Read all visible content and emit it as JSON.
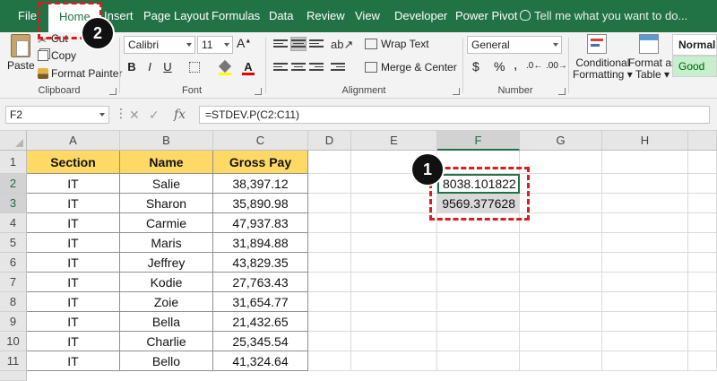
{
  "tabs": [
    {
      "id": "file",
      "label": "File"
    },
    {
      "id": "home",
      "label": "Home"
    },
    {
      "id": "insert",
      "label": "Insert"
    },
    {
      "id": "page-layout",
      "label": "Page Layout"
    },
    {
      "id": "formulas",
      "label": "Formulas"
    },
    {
      "id": "data",
      "label": "Data"
    },
    {
      "id": "review",
      "label": "Review"
    },
    {
      "id": "view",
      "label": "View"
    },
    {
      "id": "developer",
      "label": "Developer"
    },
    {
      "id": "power-pivot",
      "label": "Power Pivot"
    }
  ],
  "active_tab": "Home",
  "tell_me": "Tell me what you want to do...",
  "ribbon": {
    "clipboard": {
      "label": "Clipboard",
      "paste": "Paste",
      "cut": "Cut",
      "copy": "Copy",
      "format_painter": "Format Painter"
    },
    "font": {
      "label": "Font",
      "name": "Calibri",
      "size": "11",
      "bold": "B",
      "italic": "I",
      "underline": "U"
    },
    "alignment": {
      "label": "Alignment",
      "wrap_text": "Wrap Text",
      "merge_center": "Merge & Center"
    },
    "number": {
      "label": "Number",
      "format": "General",
      "currency": "$",
      "percent": "%",
      "comma": ","
    },
    "styles": {
      "conditional_formatting_1": "Conditional",
      "conditional_formatting_2": "Formatting",
      "format_as_table_1": "Format as",
      "format_as_table_2": "Table",
      "normal": "Normal",
      "good": "Good"
    }
  },
  "formula_bar": {
    "name_box": "F2",
    "fx": "fx",
    "formula": "=STDEV.P(C2:C11)"
  },
  "grid": {
    "columns": [
      "A",
      "B",
      "C",
      "D",
      "E",
      "F",
      "G",
      "H"
    ],
    "rows": [
      "1",
      "2",
      "3",
      "4",
      "5",
      "6",
      "7",
      "8",
      "9",
      "10",
      "11"
    ],
    "headers": [
      "Section",
      "Name",
      "Gross Pay"
    ],
    "data": [
      [
        "IT",
        "Salie",
        "38,397.12"
      ],
      [
        "IT",
        "Sharon",
        "35,890.98"
      ],
      [
        "IT",
        "Carmie",
        "47,937.83"
      ],
      [
        "IT",
        "Maris",
        "31,894.88"
      ],
      [
        "IT",
        "Jeffrey",
        "43,829.35"
      ],
      [
        "IT",
        "Kodie",
        "27,763.43"
      ],
      [
        "IT",
        "Zoie",
        "31,654.77"
      ],
      [
        "IT",
        "Bella",
        "21,432.65"
      ],
      [
        "IT",
        "Charlie",
        "25,345.54"
      ],
      [
        "IT",
        "Bello",
        "41,324.64"
      ]
    ],
    "f2": "8038.101822",
    "f3": "9569.377628"
  },
  "badges": {
    "one": "1",
    "two": "2"
  },
  "colors": {
    "excel_green": "#217346",
    "header_fill": "#ffd966",
    "callout_red": "#d61f1f"
  }
}
